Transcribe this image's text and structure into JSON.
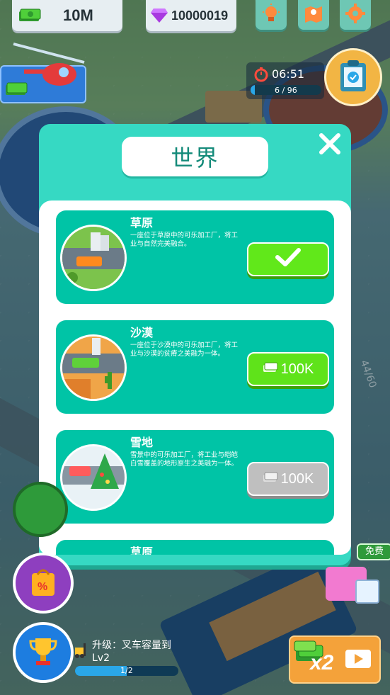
{
  "hud": {
    "money": "10M",
    "gems": "10000019",
    "timer": "06:51",
    "progress_text": "6 / 96",
    "progress_fraction": 0.0625
  },
  "modal": {
    "title": "世界",
    "worlds": [
      {
        "name": "草原",
        "description": "一座位于草原中的可乐加工厂，将工业与自然完美融合。",
        "button_state": "selected",
        "button_label": ""
      },
      {
        "name": "沙漠",
        "description": "一座位于沙漠中的可乐加工厂，将工业与沙漠的贫瘠之美融为一体。",
        "button_state": "buy",
        "button_label": "100K"
      },
      {
        "name": "雪地",
        "description": "雪景中的可乐加工厂，将工业与皑皑白雪覆盖的地形原生之美融为一体。",
        "button_state": "locked",
        "button_label": "100K"
      },
      {
        "name": "草原",
        "description": "",
        "button_state": "",
        "button_label": ""
      }
    ]
  },
  "bottom": {
    "upgrade_text": "升级：叉车容量到Lv2",
    "upgrade_progress_text": "1/2",
    "upgrade_progress_fraction": 0.5,
    "free_badge": "免费",
    "ad_multiplier": "x2",
    "counter_text": "44/60"
  },
  "colors": {
    "modal_bg": "#36d9c3",
    "card_bg": "#00c4a6",
    "selected_green": "#61e81a",
    "locked_gray": "#bfbfbf"
  },
  "icons": [
    "cash-icon",
    "gem-icon",
    "lightbulb-icon",
    "map-icon",
    "settings-icon",
    "helicopter-icon",
    "stopwatch-icon",
    "clipboard-icon",
    "close-icon",
    "check-icon",
    "trophy-icon",
    "discount-bag-icon",
    "video-icon",
    "forklift-icon"
  ]
}
